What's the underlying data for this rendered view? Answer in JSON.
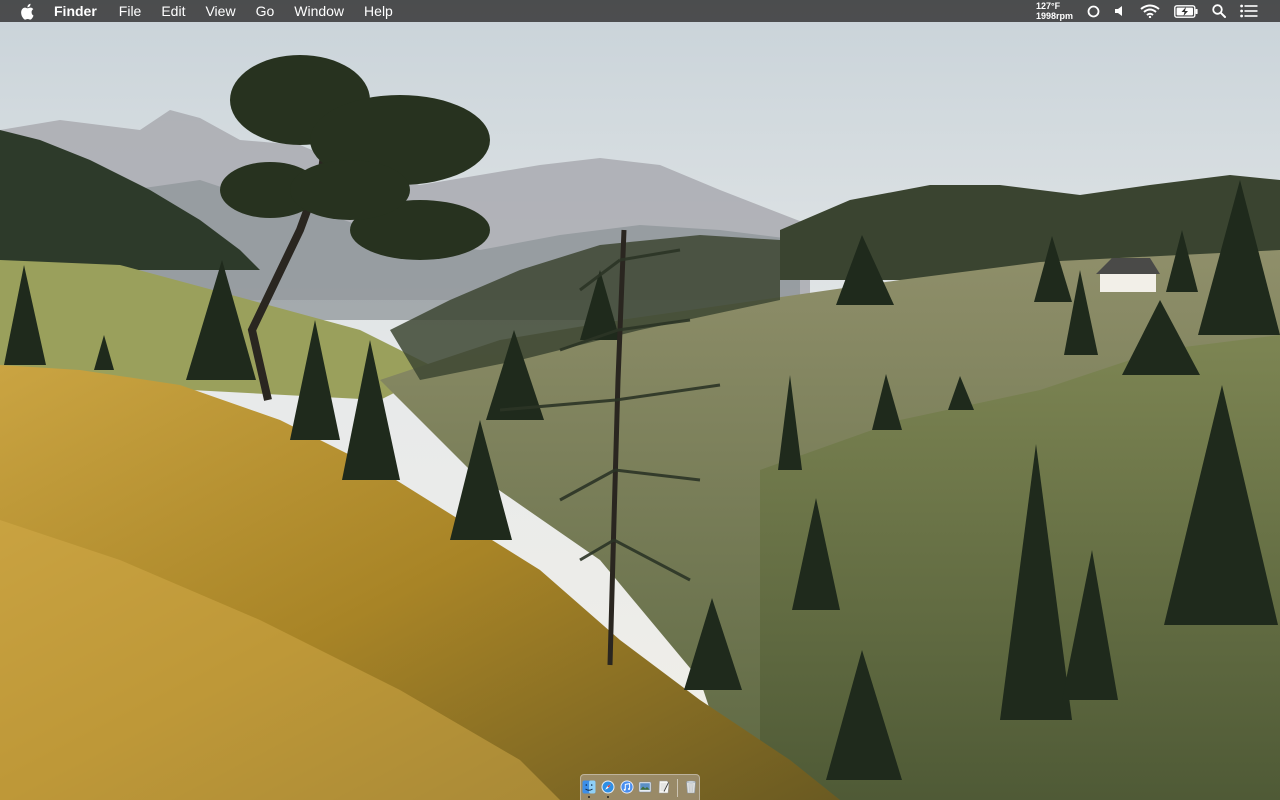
{
  "menubar": {
    "app_name": "Finder",
    "menus": [
      "File",
      "Edit",
      "View",
      "Go",
      "Window",
      "Help"
    ],
    "system_stats": {
      "temperature": "127°F",
      "fan_speed": "1998rpm"
    },
    "status_icons": [
      "record-circle-icon",
      "volume-icon",
      "wifi-icon",
      "battery-charging-icon",
      "spotlight-search-icon",
      "notification-center-icon"
    ]
  },
  "dock": {
    "items": [
      {
        "name": "Finder",
        "icon": "finder-icon",
        "running": true
      },
      {
        "name": "Safari",
        "icon": "safari-icon",
        "running": true
      },
      {
        "name": "iTunes",
        "icon": "itunes-icon",
        "running": false
      },
      {
        "name": "Preview",
        "icon": "preview-icon",
        "running": false
      },
      {
        "name": "TextEdit",
        "icon": "textedit-icon",
        "running": false
      },
      {
        "name": "Trash",
        "icon": "trash-icon",
        "running": false
      }
    ]
  },
  "colors": {
    "menubar_bg": "#303030",
    "menubar_text": "#ffffff",
    "grass": "#b8922e",
    "sky": "#e6e9ea"
  }
}
